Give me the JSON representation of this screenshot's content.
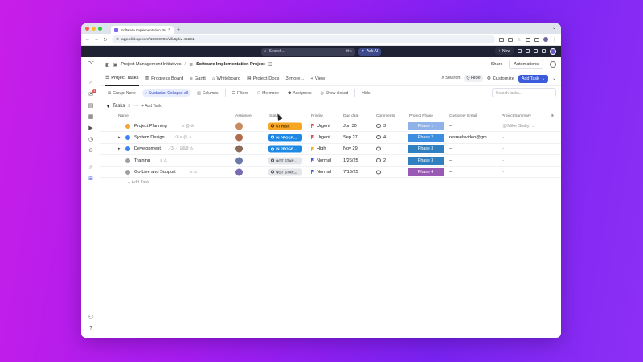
{
  "browser": {
    "tab_title": "Software Implementation Pro",
    "tab_close": "×",
    "new_tab": "+",
    "url": "app.clickup.com/10639996/v/li/6pkv-46291",
    "tab_menu": "⌄"
  },
  "topbar": {
    "search_placeholder": "Search...",
    "search_shortcut": "⌘K",
    "ask_ai": "Ask AI",
    "new_label": "New"
  },
  "breadcrumb": {
    "parent": "Project Management Initiatives",
    "separator": "/",
    "current": "Software Implementation Project",
    "share": "Share",
    "automations": "Automations"
  },
  "views": {
    "tabs": [
      "Project Tasks",
      "Progress Board",
      "Gantt",
      "Whiteboard",
      "Project Docs",
      "3 more...",
      "View"
    ],
    "search": "Search",
    "hide": "Hide",
    "customize": "Customize",
    "add_task": "Add Task"
  },
  "filters": {
    "group": "Group: None",
    "subtasks": "Subtasks: Collapse all",
    "columns": "Columns",
    "filters": "Filters",
    "me_mode": "Me mode",
    "assignees": "Assignees",
    "show_closed": "Show closed",
    "hide": "Hide",
    "search_placeholder": "Search tasks..."
  },
  "group": {
    "title": "Tasks",
    "count": "5",
    "more": "···",
    "add_task": "Add Task"
  },
  "columns": [
    "Name",
    "Assignee",
    "Status",
    "Priority",
    "Due date",
    "Comments",
    "Project Phase",
    "Customer Email",
    "Project Summary"
  ],
  "tasks": [
    {
      "name": "Project Planning",
      "meta": "≡  @ ⊘",
      "expandable": false,
      "dot": "#f2a33a",
      "avatar": "#c98a5e",
      "status": "AT RISK",
      "status_bg": "#f5a623",
      "status_fg": "#4a2d00",
      "priority": "Urgent",
      "flag": "#e5484d",
      "due": "Jun 30",
      "comments": "3",
      "phase": "Phase 1",
      "phase_bg": "#8fb3e8",
      "email": "–",
      "summary": "[@Mike Slaby] ..."
    },
    {
      "name": "System Design",
      "meta": "⟋6  ≡  @ ⚠",
      "expandable": true,
      "dot": "#3b82f6",
      "avatar": "#b06a4d",
      "status": "IN PROGR...",
      "status_bg": "#1e88e5",
      "status_fg": "#ffffff",
      "priority": "Urgent",
      "flag": "#e5484d",
      "due": "Sep 27",
      "comments": "4",
      "phase": "Phase 2",
      "phase_bg": "#3b8ee0",
      "email": "resreelsvideo@gm...",
      "summary": "–"
    },
    {
      "name": "Development",
      "meta": "⟋3  ··· ⊡0/9 ⚠",
      "expandable": true,
      "dot": "#3b82f6",
      "avatar": "#8a6a5a",
      "status": "IN PROGR...",
      "status_bg": "#1e88e5",
      "status_fg": "#ffffff",
      "priority": "High",
      "flag": "#f5a623",
      "due": "Nov 29",
      "comments": "",
      "phase": "Phase 3",
      "phase_bg": "#2f7fc1",
      "email": "–",
      "summary": "–"
    },
    {
      "name": "Training",
      "meta": "≡  ⚠",
      "expandable": false,
      "dot": "#9aa0a6",
      "avatar": "#6a7aa8",
      "status": "NOT STAR...",
      "status_bg": "#e4e6ea",
      "status_fg": "#4a4f57",
      "priority": "Normal",
      "flag": "#3b5bdb",
      "due": "1/26/25",
      "comments": "2",
      "phase": "Phase 3",
      "phase_bg": "#2f7fc1",
      "email": "–",
      "summary": "–"
    },
    {
      "name": "Go-Live and Support",
      "meta": "≡  ⚠",
      "expandable": false,
      "dot": "#9aa0a6",
      "avatar": "#7a6ab0",
      "status": "NOT STAR...",
      "status_bg": "#e4e6ea",
      "status_fg": "#4a4f57",
      "priority": "Normal",
      "flag": "#3b5bdb",
      "due": "7/13/25",
      "comments": "",
      "phase": "Phase 4",
      "phase_bg": "#9b59b6",
      "email": "–",
      "summary": "–"
    }
  ],
  "add_task_row": "+ Add Task",
  "colors": {
    "accent": "#3b5bdb",
    "background_start": "#c81ee8",
    "background_end": "#7a22f2"
  }
}
